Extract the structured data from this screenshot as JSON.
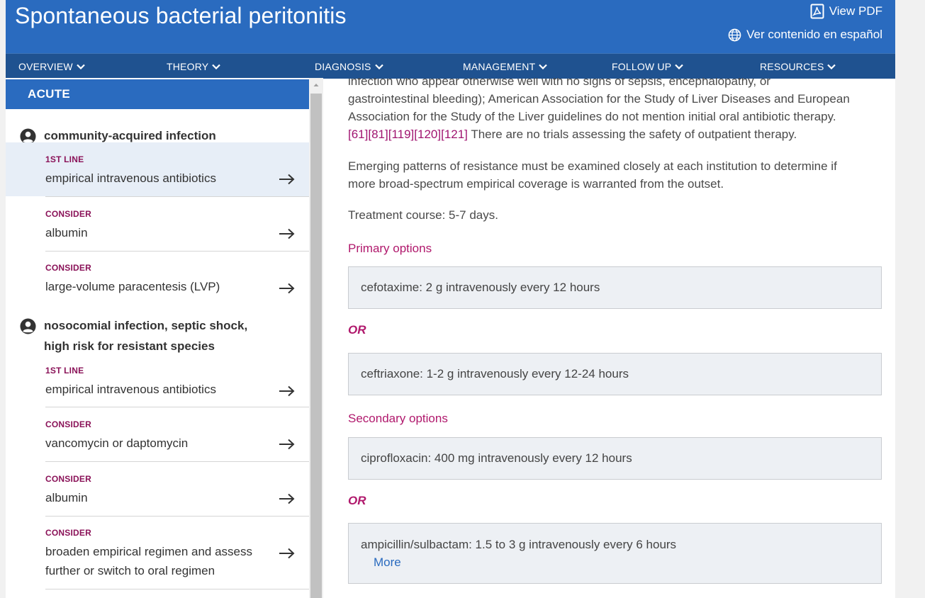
{
  "header": {
    "title": "Spontaneous bacterial peritonitis",
    "view_pdf": "View PDF",
    "language_link": "Ver contenido en español",
    "icons": [
      "pdf-icon",
      "globe-icon"
    ]
  },
  "nav": {
    "items": [
      "OVERVIEW",
      "THEORY",
      "DIAGNOSIS",
      "MANAGEMENT",
      "FOLLOW UP",
      "RESOURCES"
    ]
  },
  "left": {
    "section": "ACUTE",
    "groups": [
      {
        "title": "community-acquired infection",
        "options": [
          {
            "label": "1ST LINE",
            "text": "empirical intravenous antibiotics",
            "selected": true
          },
          {
            "label": "CONSIDER",
            "text": "albumin"
          },
          {
            "label": "CONSIDER",
            "text": "large-volume paracentesis (LVP)"
          }
        ]
      },
      {
        "title_line1": "nosocomial infection, septic shock,",
        "title_line2": "high risk for resistant species",
        "options": [
          {
            "label": "1ST LINE",
            "text": "empirical intravenous antibiotics"
          },
          {
            "label": "CONSIDER",
            "text": "vancomycin or daptomycin"
          },
          {
            "label": "CONSIDER",
            "text": "albumin"
          },
          {
            "label": "CONSIDER",
            "text_line1": "broaden empirical regimen and assess",
            "text_line2": "further or switch to oral regimen"
          }
        ]
      }
    ]
  },
  "content": {
    "para1_line0": "infection who appear otherwise well with no signs of sepsis, encephalopathy, or",
    "para1_line1": "gastrointestinal bleeding); American Association for the Study of Liver Diseases and European",
    "para1_line2": "Association for the Study of the Liver guidelines do not mention initial oral antibiotic therapy.",
    "citations": [
      "[61]",
      "[81]",
      "[119]",
      "[120]",
      "[121]"
    ],
    "para1_tail": " There are no trials assessing the safety of outpatient therapy.",
    "para2_line1": "Emerging patterns of resistance must be examined closely at each institution to determine if",
    "para2_line2": "more broad-spectrum empirical coverage is warranted from the outset.",
    "treatment_course": "Treatment course: 5-7 days.",
    "primary_heading": "Primary options",
    "or_label": "OR",
    "primary": [
      "cefotaxime: 2 g intravenously every 12 hours",
      "ceftriaxone: 1-2 g intravenously every 12-24 hours"
    ],
    "secondary_heading": "Secondary options",
    "secondary": [
      "ciprofloxacin: 400 mg intravenously every 12 hours",
      "ampicillin/sulbactam: 1.5 to 3 g intravenously every 6 hours"
    ],
    "more_link": "More"
  },
  "colors": {
    "header_blue": "#2a6bbf",
    "nav_blue": "#1f5290",
    "magenta_label": "#8a1258",
    "magenta_heading": "#b0186c",
    "drug_box": "#edf0f4"
  }
}
